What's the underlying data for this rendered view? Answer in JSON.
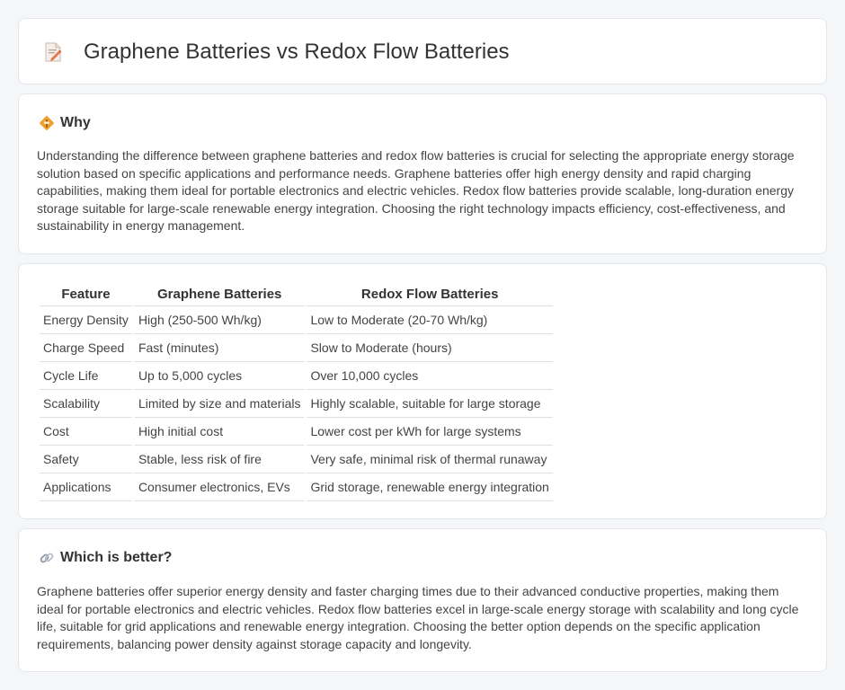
{
  "page": {
    "title": "Graphene Batteries vs Redox Flow Batteries",
    "title_icon": "document-pencil-icon"
  },
  "why": {
    "heading": "Why",
    "icon": "signpost-icon",
    "body": "Understanding the difference between graphene batteries and redox flow batteries is crucial for selecting the appropriate energy storage solution based on specific applications and performance needs. Graphene batteries offer high energy density and rapid charging capabilities, making them ideal for portable electronics and electric vehicles. Redox flow batteries provide scalable, long-duration energy storage suitable for large-scale renewable energy integration. Choosing the right technology impacts efficiency, cost-effectiveness, and sustainability in energy management."
  },
  "table": {
    "headers": [
      "Feature",
      "Graphene Batteries",
      "Redox Flow Batteries"
    ],
    "rows": [
      [
        "Energy Density",
        "High (250-500 Wh/kg)",
        "Low to Moderate (20-70 Wh/kg)"
      ],
      [
        "Charge Speed",
        "Fast (minutes)",
        "Slow to Moderate (hours)"
      ],
      [
        "Cycle Life",
        "Up to 5,000 cycles",
        "Over 10,000 cycles"
      ],
      [
        "Scalability",
        "Limited by size and materials",
        "Highly scalable, suitable for large storage"
      ],
      [
        "Cost",
        "High initial cost",
        "Lower cost per kWh for large systems"
      ],
      [
        "Safety",
        "Stable, less risk of fire",
        "Very safe, minimal risk of thermal runaway"
      ],
      [
        "Applications",
        "Consumer electronics, EVs",
        "Grid storage, renewable energy integration"
      ]
    ]
  },
  "better": {
    "heading": "Which is better?",
    "icon": "link-icon",
    "body": "Graphene batteries offer superior energy density and faster charging times due to their advanced conductive properties, making them ideal for portable electronics and electric vehicles. Redox flow batteries excel in large-scale energy storage with scalability and long cycle life, suitable for grid applications and renewable energy integration. Choosing the better option depends on the specific application requirements, balancing power density against storage capacity and longevity."
  },
  "colors": {
    "background": "#f5f6f8",
    "card": "#ffffff",
    "border": "#e3e6ea",
    "signpost_icon": "#f0a030"
  }
}
